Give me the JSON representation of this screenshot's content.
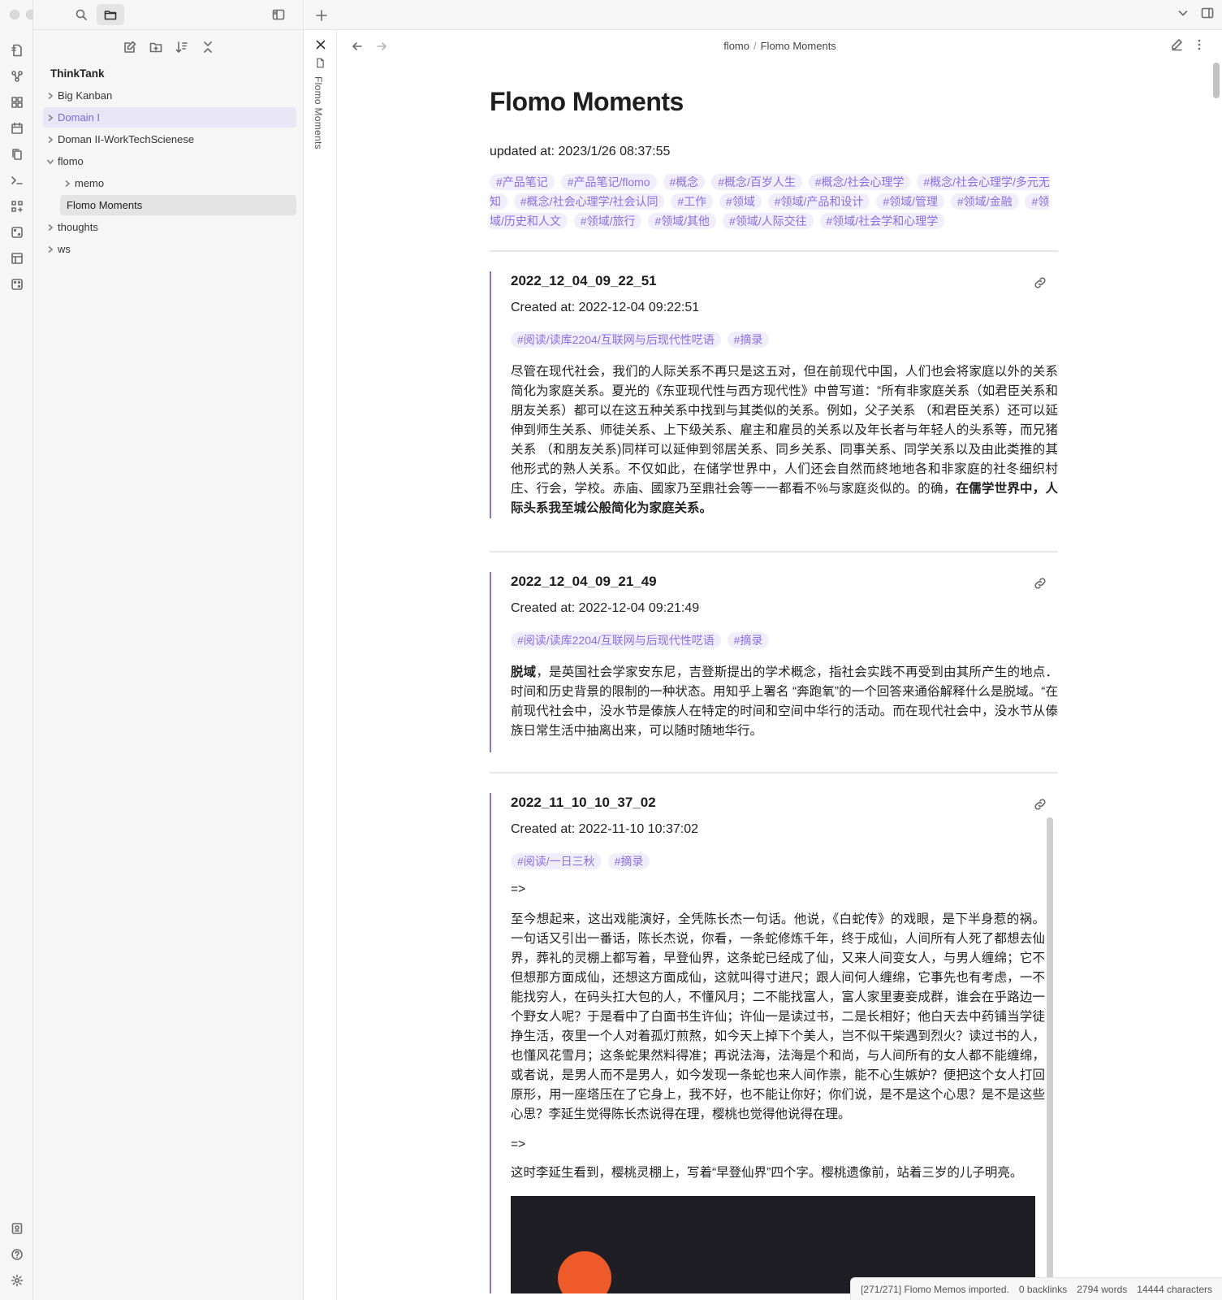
{
  "sidebar": {
    "vault_name": "ThinkTank",
    "items": [
      {
        "label": "Big Kanban"
      },
      {
        "label": "Domain I"
      },
      {
        "label": "Doman II-WorkTechScienese"
      },
      {
        "label": "flomo"
      },
      {
        "label": "memo"
      },
      {
        "label": "Flomo Moments"
      },
      {
        "label": "thoughts"
      },
      {
        "label": "ws"
      }
    ]
  },
  "spine": {
    "title": "Flomo Moments"
  },
  "breadcrumb": {
    "folder": "flomo",
    "sep": "/",
    "file": "Flomo Moments"
  },
  "doc": {
    "title": "Flomo Moments",
    "updated": "updated at: 2023/1/26 08:37:55",
    "tags": [
      "#产品笔记",
      "#产品笔记/flomo",
      "#概念",
      "#概念/百岁人生",
      "#概念/社会心理学",
      "#概念/社会心理学/多元无知",
      "#概念/社会心理学/社会认同",
      "#工作",
      "#领域",
      "#领域/产品和设计",
      "#领域/管理",
      "#领域/金融",
      "#领域/历史和人文",
      "#领域/旅行",
      "#领域/其他",
      "#领域/人际交往",
      "#领域/社会学和心理学"
    ]
  },
  "memos": [
    {
      "title": "2022_12_04_09_22_51",
      "created": "Created at: 2022-12-04 09:22:51",
      "tags": [
        "#阅读/读库2204/互联网与后现代性呓语",
        "#摘录"
      ],
      "body": "尽管在现代社会，我们的人际关系不再只是这五对，但在前现代中国，人们也会将家庭以外的关系简化为家庭关系。夏光的《东亚现代性与西方现代性》中曾写道：“所有非家庭关系（如君臣关系和朋友关系）都可以在这五种关系中找到与其类似的关系。例如，父子关系 （和君臣关系）还可以延伸到师生关系、师徒关系、上下级关系、雇主和雇员的关系以及年长者与年轻人的头系等，而兄猪关系 （和朋友关系)同样可以延伸到邻居关系、同乡关系、同事关系、同学关系以及由此类推的其他形式的熟人关系。不仅如此，在储学世界中，人们还会自然而終地地各和非家庭的社冬细织村庄、行会，学校。赤庙、國家乃至鼎社会等一一都看不%与家庭炎似的。的确，",
      "body_bold": "在儒学世界中，人际头系我至城公般简化为家庭关系。"
    },
    {
      "title": "2022_12_04_09_21_49",
      "created": "Created at: 2022-12-04 09:21:49",
      "tags": [
        "#阅读/读库2204/互联网与后现代性呓语",
        "#摘录"
      ],
      "body_bold": "脱域",
      "body": "，是英国社会学家安东尼，吉登斯提出的学术概念，指社会实践不再受到由其所产生的地点．时间和历史背景的限制的一种状态。用知乎上署名 “奔跑氧”的一个回答来通俗解释什么是脱域。“在前现代社会中，没水节是傣族人在特定的时间和空间中华行的活动。而在现代社会中，没水节从傣族日常生活中抽离出来，可以随时随地华行。"
    },
    {
      "title": "2022_11_10_10_37_02",
      "created": "Created at: 2022-11-10 10:37:02",
      "tags": [
        "#阅读/一日三秋",
        "#摘录"
      ],
      "arrow1": "=>",
      "body": "至今想起来，这出戏能演好，全凭陈长杰一句话。他说，《白蛇传》的戏眼，是下半身惹的祸。一句话又引出一番话，陈长杰说，你看，一条蛇修炼千年，终于成仙，人间所有人死了都想去仙界，葬礼的灵棚上都写着，早登仙界，这条蛇已经成了仙，又来人间变女人，与男人缠绵；它不但想那方面成仙，还想这方面成仙，这就叫得寸进尺；跟人间何人缠绵，它事先也有考虑，一不能找穷人，在码头扛大包的人，不懂风月；二不能找富人，富人家里妻妾成群，谁会在乎路边一个野女人呢？于是看中了白面书生许仙；许仙一是读过书，二是长相好；他白天去中药铺当学徒挣生活，夜里一个人对着孤灯煎熬，如今天上掉下个美人，岂不似干柴遇到烈火？读过书的人，也懂风花雪月；这条蛇果然料得准；再说法海，法海是个和尚，与人间所有的女人都不能缠绵，或者说，是男人而不是男人，如今发现一条蛇也来人间作祟，能不心生嫉妒？便把这个女人打回原形，用一座塔压在了它身上，我不好，也不能让你好；你们说，是不是这个心思？是不是这些心思？李延生觉得陈长杰说得在理，樱桃也觉得他说得在理。",
      "arrow2": "=>",
      "para2": "这时李延生看到，樱桃灵棚上，写着“早登仙界”四个字。樱桃遗像前，站着三岁的儿子明亮。"
    }
  ],
  "status": {
    "import": "[271/271] Flomo Memos imported.",
    "backlinks": "0 backlinks",
    "words": "2794 words",
    "chars": "14444 characters"
  },
  "colors": {
    "accent": "#8a70e0",
    "tag_bg": "#f1eefc",
    "selected_bg": "#e8e5f6"
  }
}
